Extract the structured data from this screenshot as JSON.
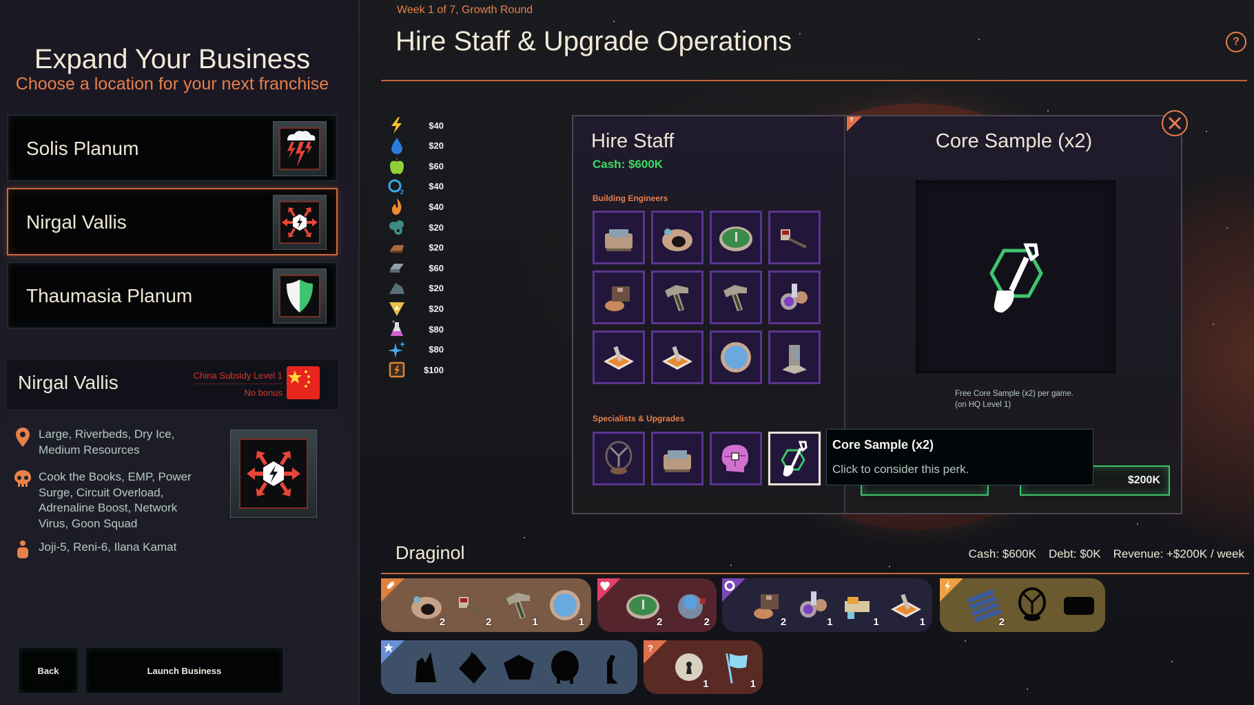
{
  "left_panel": {
    "title": "Expand Your Business",
    "subtitle": "Choose a location for your next franchise",
    "locations": [
      {
        "name": "Solis Planum",
        "icon": "storm-lightning-icon",
        "selected": false
      },
      {
        "name": "Nirgal Vallis",
        "icon": "power-surge-icon",
        "selected": true
      },
      {
        "name": "Thaumasia Planum",
        "icon": "shield-icon",
        "selected": false
      }
    ],
    "info": {
      "name": "Nirgal Vallis",
      "subsidy_label": "China Subsidy Level 1",
      "subsidy_bonus": "No bonus",
      "flag": "china-flag",
      "terrain_icon": "location-pin-icon",
      "terrain": "Large, Riverbeds, Dry Ice, Medium Resources",
      "threats_icon": "skull-icon",
      "threats": "Cook the Books, EMP, Power Surge, Circuit Overload, Adrenaline Boost, Network Virus, Goon Squad",
      "people_icon": "person-icon",
      "people": "Joji-5, Reni-6, Ilana Kamat"
    },
    "buttons": {
      "back": "Back",
      "launch": "Launch Business"
    }
  },
  "header": {
    "week_label": "Week 1 of 7, Growth Round",
    "title": "Hire Staff & Upgrade Operations",
    "help": "?"
  },
  "resources": [
    {
      "icon": "power-icon",
      "price": "$40",
      "color": "#f4c430"
    },
    {
      "icon": "water-icon",
      "price": "$20",
      "color": "#2a7be0"
    },
    {
      "icon": "food-icon",
      "price": "$60",
      "color": "#8fd13a"
    },
    {
      "icon": "oxygen-icon",
      "price": "$40",
      "color": "#3aa8e8"
    },
    {
      "icon": "heat-icon",
      "price": "$40",
      "color": "#f08a30"
    },
    {
      "icon": "carbon-icon",
      "price": "$20",
      "color": "#3f8a86"
    },
    {
      "icon": "metal-ingot-icon",
      "price": "$20",
      "color": "#a86a3e"
    },
    {
      "icon": "steel-icon",
      "price": "$60",
      "color": "#8fa0a8"
    },
    {
      "icon": "rock-icon",
      "price": "$20",
      "color": "#5a7078"
    },
    {
      "icon": "triangle-mineral-icon",
      "price": "$20",
      "color": "#e8c04a"
    },
    {
      "icon": "chemicals-icon",
      "price": "$80",
      "color": "#d060d0"
    },
    {
      "icon": "sparkle-icon",
      "price": "$80",
      "color": "#48a8f0"
    },
    {
      "icon": "microchip-icon",
      "price": "$100",
      "color": "#d88838"
    }
  ],
  "hire_staff": {
    "title": "Hire Staff",
    "cash": "Cash: $600K",
    "building_engineers_label": "Building Engineers",
    "building_engineers": [
      "generator-building",
      "excavation-pit",
      "farm-dome",
      "drill-rig",
      "refinery-machine",
      "ramp-factory",
      "ramp-factory",
      "reactor-complex",
      "landing-pad",
      "landing-pad",
      "solar-dome",
      "laser-tower"
    ],
    "specialists_label": "Specialists & Upgrades",
    "specialists": [
      {
        "name": "gyroscope-turbine",
        "selected": false
      },
      {
        "name": "generator-building",
        "selected": false
      },
      {
        "name": "brain-chip",
        "selected": false
      },
      {
        "name": "core-sample",
        "selected": true
      }
    ]
  },
  "detail": {
    "title": "Core Sample (x2)",
    "description_line1": "Free Core Sample (x2) per game.",
    "description_line2": "(on HQ Level 1)",
    "price": "$200K",
    "help_corner": "?"
  },
  "tooltip": {
    "title": "Core Sample (x2)",
    "body": "Click to consider this perk."
  },
  "company": {
    "name": "Draginol",
    "cash": "Cash: $600K",
    "debt": "Debt: $0K",
    "revenue": "Revenue: +$200K / week"
  },
  "inventory": [
    {
      "category": "shovel-icon",
      "color": "#7a5a44",
      "corner": "#e0803a",
      "items": [
        {
          "name": "excavation-pit",
          "count": "2"
        },
        {
          "name": "drill-rig",
          "count": "2"
        },
        {
          "name": "ramp-factory",
          "count": "1"
        },
        {
          "name": "solar-dome",
          "count": "1"
        }
      ]
    },
    {
      "category": "heart-icon",
      "color": "#55252e",
      "corner": "#e0406a",
      "items": [
        {
          "name": "farm-dome",
          "count": "2"
        },
        {
          "name": "plasma-reactor",
          "count": "2"
        }
      ]
    },
    {
      "category": "gear-icon",
      "color": "#24233a",
      "corner": "#7a4ab8",
      "items": [
        {
          "name": "refinery-machine",
          "count": "2"
        },
        {
          "name": "reactor-complex",
          "count": "1"
        },
        {
          "name": "supply-depot",
          "count": "1"
        },
        {
          "name": "landing-pad",
          "count": "1"
        }
      ]
    },
    {
      "category": "lightning-icon",
      "color": "#6a5a30",
      "corner": "#f0a040",
      "items": [
        {
          "name": "solar-panels",
          "count": "2"
        },
        {
          "name": "gyroscope-silhouette",
          "count": ""
        },
        {
          "name": "generator-silhouette",
          "count": ""
        }
      ]
    },
    {
      "category": "star-icon",
      "color": "#3e5068",
      "corner": "#6a90d8",
      "items": [
        {
          "name": "tower-silhouette",
          "count": ""
        },
        {
          "name": "block-silhouette",
          "count": ""
        },
        {
          "name": "pentagon-silhouette",
          "count": ""
        },
        {
          "name": "dome-silhouette",
          "count": ""
        },
        {
          "name": "crane-silhouette",
          "count": ""
        }
      ]
    },
    {
      "category": "question-icon",
      "color": "#5a2a24",
      "corner": "#e0704a",
      "items": [
        {
          "name": "keyhole-gear",
          "count": "1"
        },
        {
          "name": "flag",
          "count": "1"
        }
      ]
    }
  ]
}
